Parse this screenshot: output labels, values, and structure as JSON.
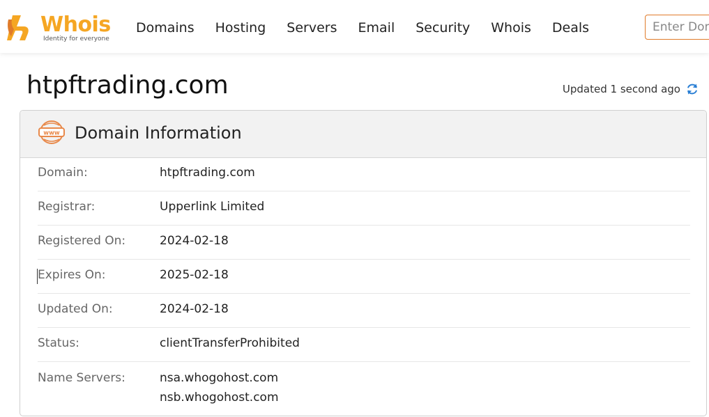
{
  "brand": {
    "name": "Whois",
    "tagline": "Identity for everyone",
    "primary_color": "#f5a623",
    "accent_color": "#e07b2a"
  },
  "nav": {
    "items": [
      {
        "label": "Domains"
      },
      {
        "label": "Hosting"
      },
      {
        "label": "Servers"
      },
      {
        "label": "Email"
      },
      {
        "label": "Security"
      },
      {
        "label": "Whois"
      },
      {
        "label": "Deals"
      }
    ],
    "search_placeholder": "Enter Domain"
  },
  "page": {
    "title": "htpftrading.com",
    "updated_text": "Updated 1 second ago",
    "refresh_icon": "refresh-icon"
  },
  "card": {
    "title": "Domain Information",
    "icon": "www-icon",
    "rows": [
      {
        "label": "Domain:",
        "value": "htpftrading.com"
      },
      {
        "label": "Registrar:",
        "value": "Upperlink Limited"
      },
      {
        "label": "Registered On:",
        "value": "2024-02-18"
      },
      {
        "label": "Expires On:",
        "value": "2025-02-18"
      },
      {
        "label": "Updated On:",
        "value": "2024-02-18"
      },
      {
        "label": "Status:",
        "value": "clientTransferProhibited"
      },
      {
        "label": "Name Servers:",
        "values": [
          "nsa.whogohost.com",
          "nsb.whogohost.com"
        ]
      }
    ]
  }
}
